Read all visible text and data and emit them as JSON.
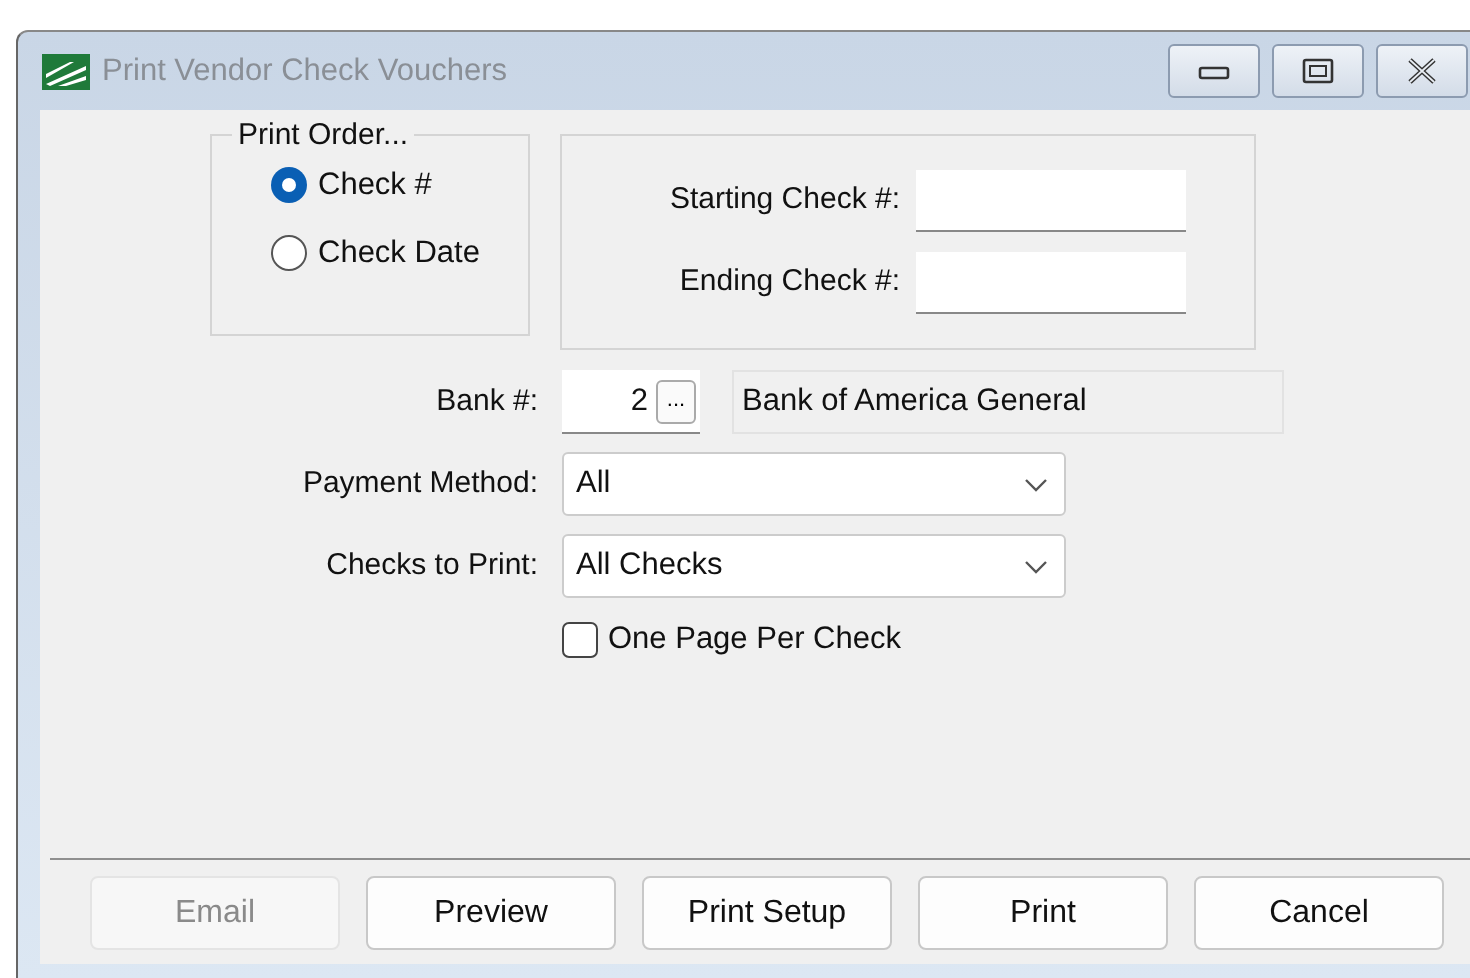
{
  "window": {
    "title": "Print Vendor Check Vouchers",
    "controls": [
      {
        "kind": "minimize"
      },
      {
        "kind": "maximize"
      },
      {
        "kind": "close"
      }
    ]
  },
  "print_order": {
    "title": "Print Order...",
    "options": [
      {
        "label": "Check #",
        "selected": true
      },
      {
        "label": "Check Date",
        "selected": false
      }
    ]
  },
  "check_range": [
    {
      "label": "Starting Check #:"
    },
    {
      "label": "Ending Check #:"
    }
  ],
  "bank": {
    "label": "Bank #:",
    "number": "2",
    "browse": "...",
    "name": "Bank of America General"
  },
  "selects": [
    {
      "label": "Payment Method:",
      "value": "All"
    },
    {
      "label": "Checks to Print:",
      "value": "All Checks"
    }
  ],
  "one_page_per_check": {
    "label": "One Page Per Check",
    "checked": false
  },
  "buttons": [
    {
      "label": "Email",
      "disabled": true
    },
    {
      "label": "Preview",
      "disabled": false
    },
    {
      "label": "Print Setup",
      "disabled": false
    },
    {
      "label": "Print",
      "disabled": false
    },
    {
      "label": "Cancel",
      "disabled": false
    }
  ]
}
